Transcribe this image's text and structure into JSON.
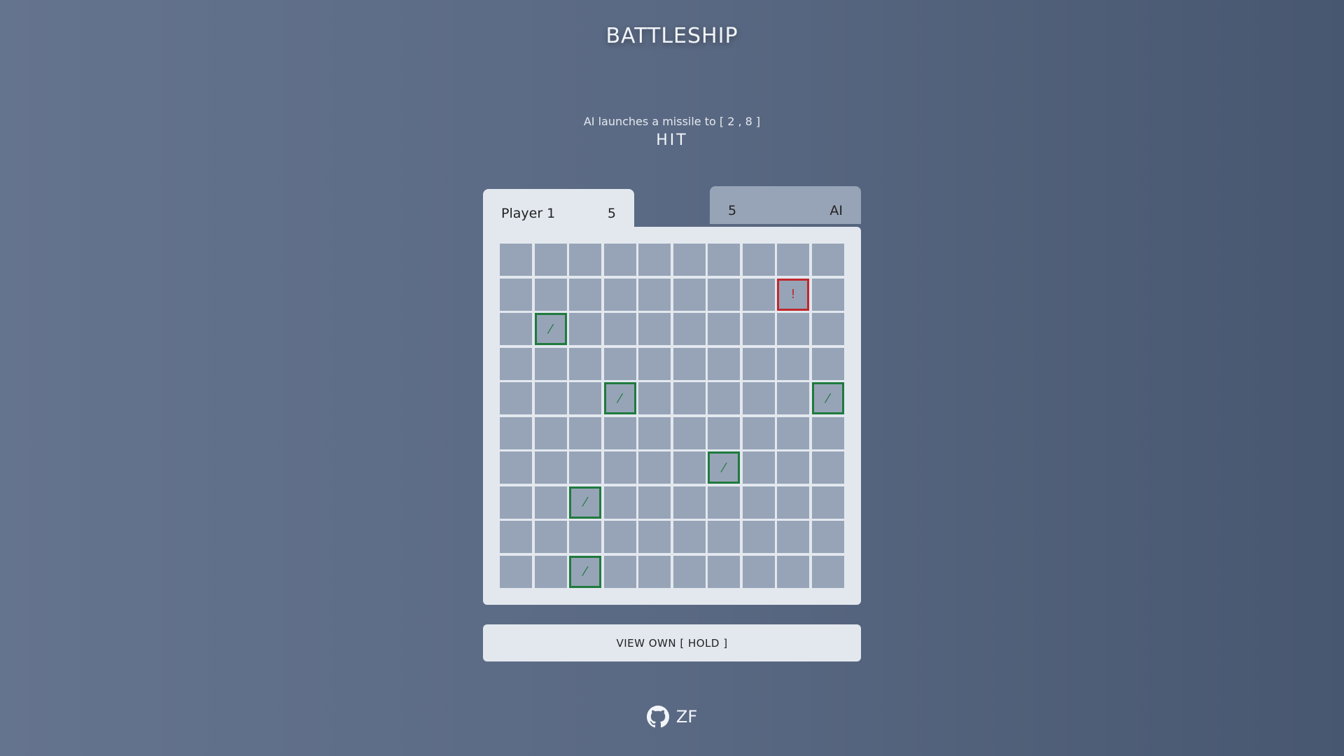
{
  "title": "BATTLESHIP",
  "status": {
    "message": "AI launches a missile to [ 2 , 8 ]",
    "result": "HIT"
  },
  "player_tab": {
    "name": "Player 1",
    "ships": "5"
  },
  "ai_tab": {
    "ships": "5",
    "name": "AI"
  },
  "board": {
    "rows": 10,
    "cols": 10,
    "hit_symbol": "!",
    "miss_symbol": "⁄",
    "cells": [
      {
        "row": 1,
        "col": 8,
        "state": "hit"
      },
      {
        "row": 2,
        "col": 1,
        "state": "miss"
      },
      {
        "row": 4,
        "col": 3,
        "state": "miss"
      },
      {
        "row": 4,
        "col": 9,
        "state": "miss"
      },
      {
        "row": 6,
        "col": 6,
        "state": "miss"
      },
      {
        "row": 7,
        "col": 2,
        "state": "miss"
      },
      {
        "row": 9,
        "col": 2,
        "state": "miss"
      }
    ]
  },
  "view_button": "VIEW OWN [ HOLD ]",
  "footer": {
    "icon": "github-icon",
    "label": "ZF"
  },
  "colors": {
    "cell": "#97a4b7",
    "panel": "#e3e8ef",
    "hit": "#c0282d",
    "miss": "#1f7a3e"
  }
}
